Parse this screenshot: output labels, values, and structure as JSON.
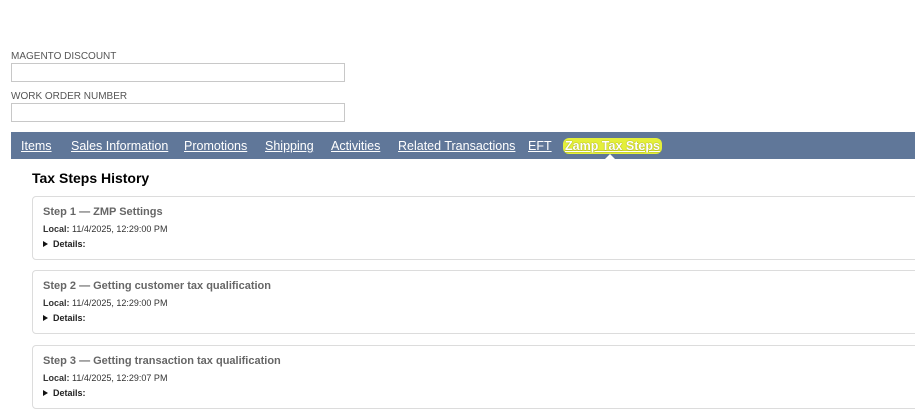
{
  "fields": {
    "magento_discount": {
      "label": "MAGENTO DISCOUNT",
      "value": ""
    },
    "work_order_number": {
      "label": "WORK ORDER NUMBER",
      "value": ""
    }
  },
  "tabs": [
    {
      "label": "Items"
    },
    {
      "label": "Sales Information"
    },
    {
      "label": "Promotions"
    },
    {
      "label": "Shipping"
    },
    {
      "label": "Activities"
    },
    {
      "label": "Related Transactions"
    },
    {
      "label": "EFT"
    },
    {
      "label": "Zamp Tax Steps",
      "active": true
    }
  ],
  "section": {
    "title": "Tax Steps History"
  },
  "steps": [
    {
      "title": "Step 1 — ZMP Settings",
      "local_label": "Local:",
      "local_value": "11/4/2025, 12:29:00 PM",
      "details_label": "Details:"
    },
    {
      "title": "Step 2 — Getting customer tax qualification",
      "local_label": "Local:",
      "local_value": "11/4/2025, 12:29:00 PM",
      "details_label": "Details:"
    },
    {
      "title": "Step 3 — Getting transaction tax qualification",
      "local_label": "Local:",
      "local_value": "11/4/2025, 12:29:07 PM",
      "details_label": "Details:"
    }
  ],
  "colors": {
    "tabbar": "#607799",
    "highlight": "#e4ef3a"
  },
  "icons": {
    "details_toggle": "caret-right-icon",
    "active_tab": "caret-up-icon"
  }
}
